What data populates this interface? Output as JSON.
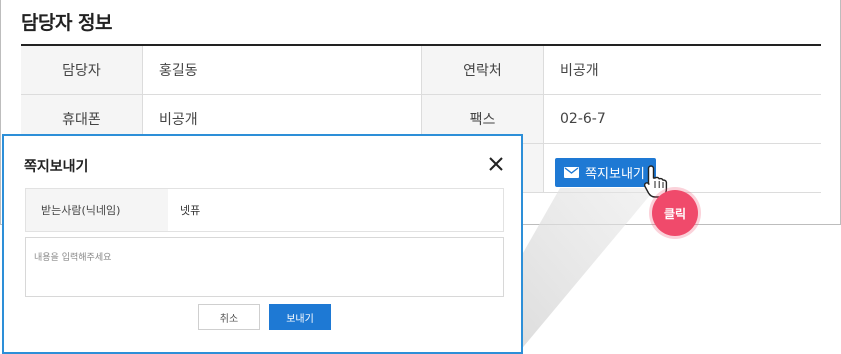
{
  "section": {
    "title": "담당자 정보"
  },
  "info": {
    "manager_label": "담당자",
    "manager_value": "홍길동",
    "contact_label": "연락처",
    "contact_value": "비공개",
    "mobile_label": "휴대폰",
    "mobile_value": "비공개",
    "fax_label": "팩스",
    "fax_value": "02-6-7"
  },
  "send_button": {
    "label": "쪽지보내기",
    "icon": "mail-icon",
    "color": "#1e79d4"
  },
  "click_badge": {
    "label": "클릭",
    "color": "#f04a6b"
  },
  "modal": {
    "title": "쪽지보내기",
    "recipient_label": "받는사람(닉네임)",
    "recipient_value": "넷퓨",
    "message_placeholder": "내용을 입력해주세요",
    "cancel_label": "취소",
    "submit_label": "보내기",
    "border_color": "#2d8fd8"
  }
}
